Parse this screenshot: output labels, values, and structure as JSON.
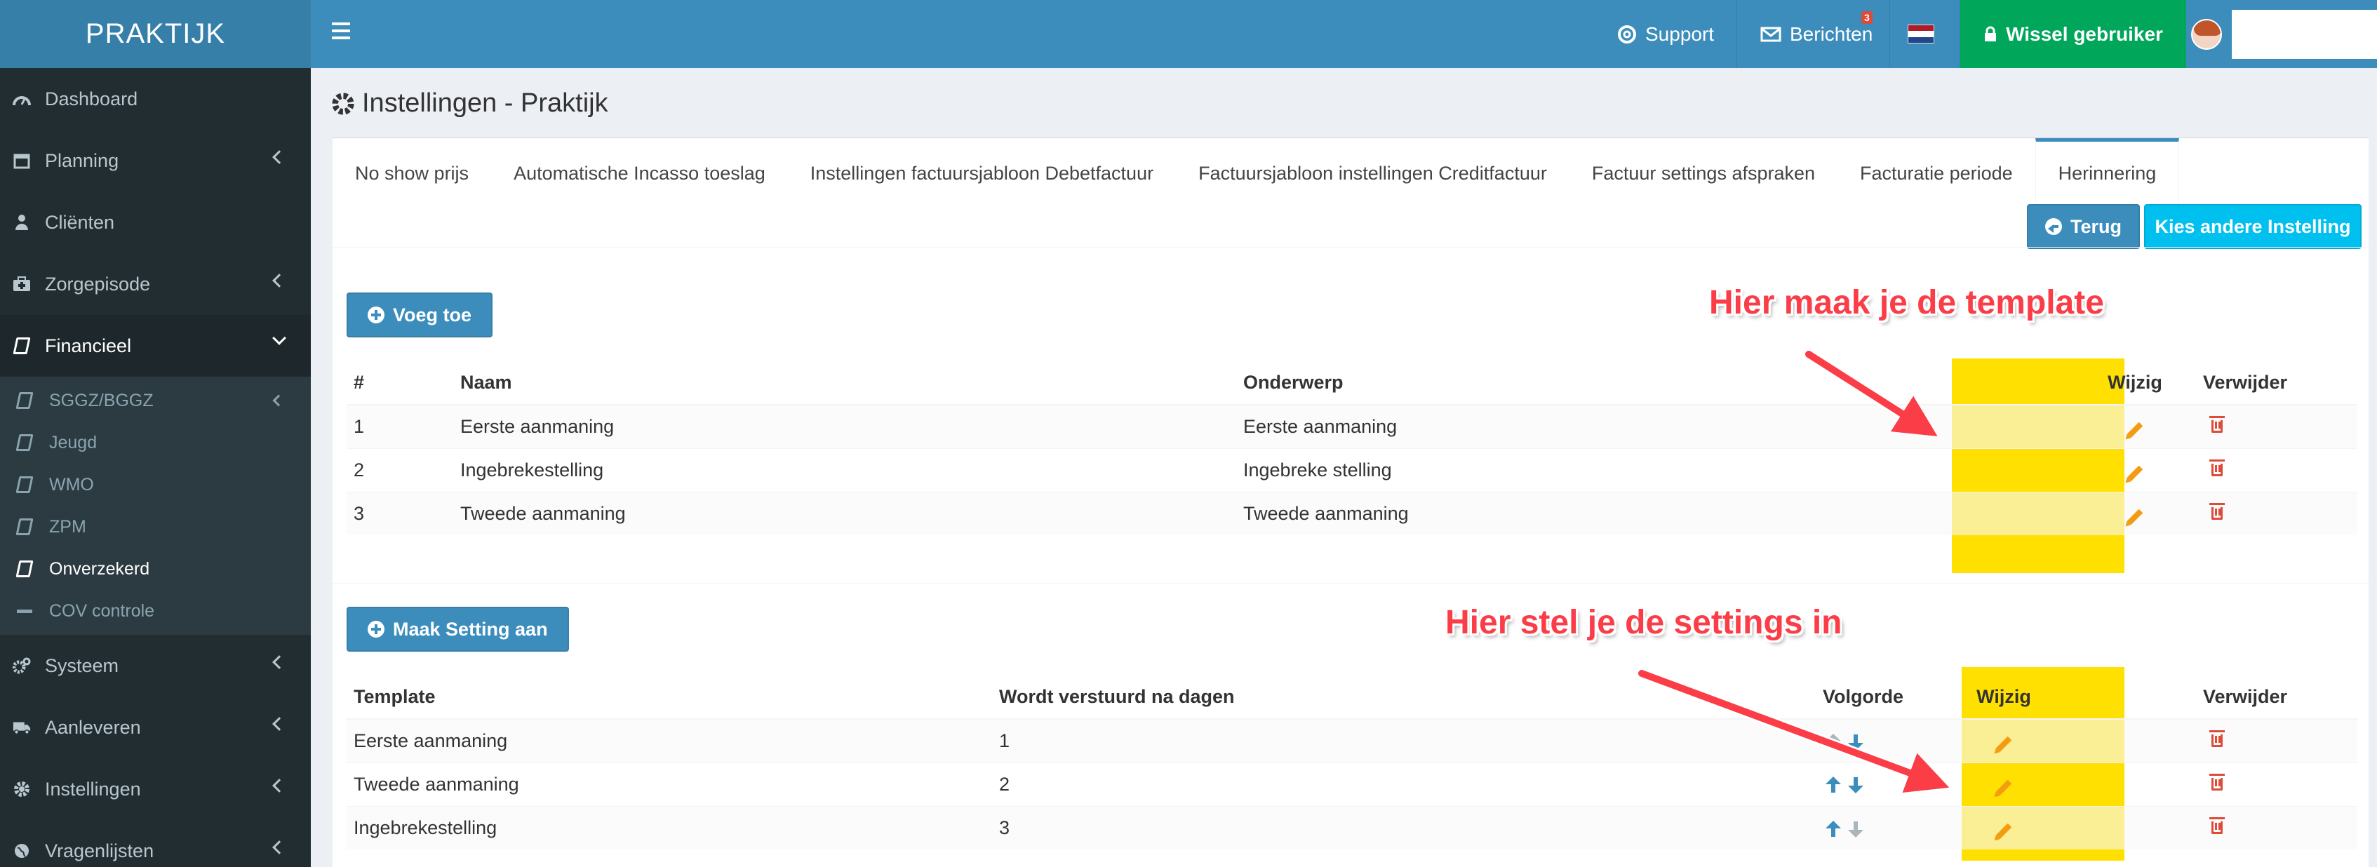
{
  "app": {
    "logo": "PRAKTIJK"
  },
  "topnav": {
    "support": "Support",
    "berichten": "Berichten",
    "berichten_badge": "3",
    "wissel": "Wissel gebruiker"
  },
  "sidebar": {
    "items": [
      {
        "label": "Dashboard",
        "icon": "dashboard-icon"
      },
      {
        "label": "Planning",
        "icon": "calendar-icon"
      },
      {
        "label": "Cliënten",
        "icon": "user-icon"
      },
      {
        "label": "Zorgepisode",
        "icon": "medkit-icon"
      },
      {
        "label": "Financieel",
        "icon": "book-icon"
      },
      {
        "label": "Systeem",
        "icon": "cogs-icon"
      },
      {
        "label": "Aanleveren",
        "icon": "truck-icon"
      },
      {
        "label": "Instellingen",
        "icon": "gear-icon"
      },
      {
        "label": "Vragenlijsten",
        "icon": "globe-icon"
      }
    ],
    "submenu": [
      {
        "label": "SGGZ/BGGZ"
      },
      {
        "label": "Jeugd"
      },
      {
        "label": "WMO"
      },
      {
        "label": "ZPM"
      },
      {
        "label": "Onverzekerd"
      },
      {
        "label": "COV controle"
      }
    ]
  },
  "page": {
    "title": "Instellingen - Praktijk"
  },
  "tabs": [
    "No show prijs",
    "Automatische Incasso toeslag",
    "Instellingen factuursjabloon Debetfactuur",
    "Factuursjabloon instellingen Creditfactuur",
    "Factuur settings afspraken",
    "Facturatie periode",
    "Herinnering"
  ],
  "buttons": {
    "terug": "Terug",
    "kies": "Kies andere Instelling",
    "voeg_toe": "Voeg toe",
    "maak_setting": "Maak Setting aan"
  },
  "templates_table": {
    "headers": {
      "num": "#",
      "naam": "Naam",
      "onderwerp": "Onderwerp",
      "wijzig": "Wijzig",
      "verwijder": "Verwijder"
    },
    "rows": [
      {
        "num": "1",
        "naam": "Eerste aanmaning",
        "onderwerp": "Eerste aanmaning"
      },
      {
        "num": "2",
        "naam": "Ingebrekestelling",
        "onderwerp": "Ingebreke stelling"
      },
      {
        "num": "3",
        "naam": "Tweede aanmaning",
        "onderwerp": "Tweede aanmaning"
      }
    ]
  },
  "settings_table": {
    "headers": {
      "template": "Template",
      "dagen": "Wordt verstuurd na dagen",
      "volgorde": "Volgorde",
      "wijzig": "Wijzig",
      "verwijder": "Verwijder"
    },
    "rows": [
      {
        "template": "Eerste aanmaning",
        "dagen": "1"
      },
      {
        "template": "Tweede aanmaning",
        "dagen": "2"
      },
      {
        "template": "Ingebrekestelling",
        "dagen": "3"
      }
    ]
  },
  "annotations": {
    "template": "Hier maak je de template",
    "settings": "Hier stel je de settings in"
  },
  "colors": {
    "topbar": "#3c8dbc",
    "sidebar": "#222d32",
    "highlight": "#ffe000",
    "annotation": "#fb3d48",
    "switch_user": "#00a65a"
  }
}
